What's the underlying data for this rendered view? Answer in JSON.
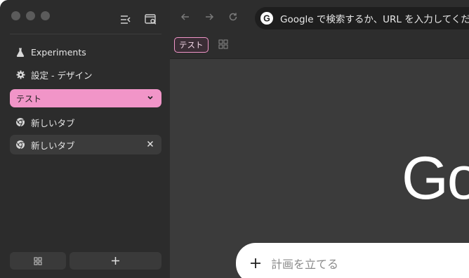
{
  "sidebar": {
    "items": [
      {
        "label": "Experiments",
        "icon": "flask-icon"
      },
      {
        "label": "設定 - デザイン",
        "icon": "gear-icon"
      }
    ],
    "group": {
      "label": "テスト",
      "color": "#f195c8"
    },
    "tabs": [
      {
        "label": "新しいタブ",
        "icon": "chrome-icon"
      },
      {
        "label": "新しいタブ",
        "icon": "chrome-icon"
      }
    ]
  },
  "toolbar": {
    "omnibox_text": "Google で検索するか、URL を入力してください"
  },
  "bookmarks": {
    "group_label": "テスト"
  },
  "main": {
    "logo_text": "Go",
    "task_placeholder": "計画を立てる"
  }
}
